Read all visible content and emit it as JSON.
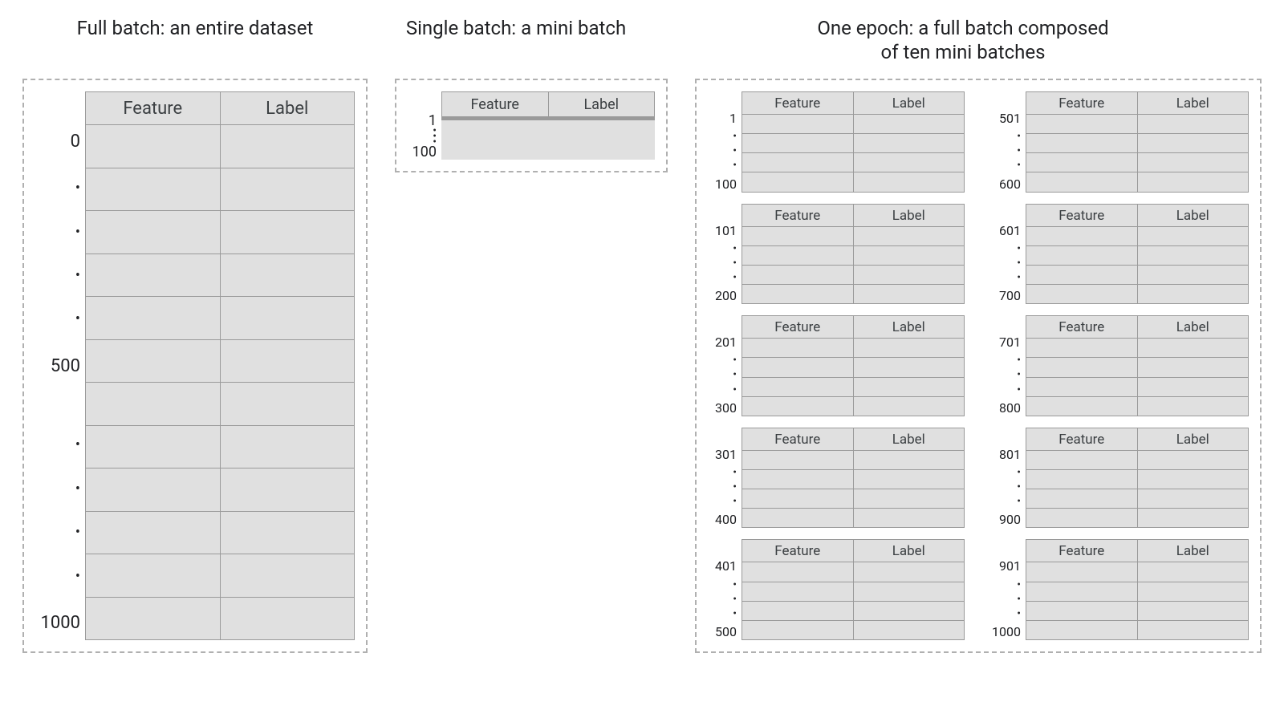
{
  "titles": {
    "full": "Full batch: an entire dataset",
    "single": "Single batch: a mini batch",
    "epoch": "One epoch: a full batch composed\nof ten mini batches"
  },
  "headers": {
    "feature": "Feature",
    "label": "Label"
  },
  "full_batch": {
    "row_labels": [
      "0",
      "•",
      "•",
      "•",
      "•",
      "500",
      "",
      "•",
      "•",
      "•",
      "•",
      "1000"
    ],
    "n_rows": 12
  },
  "single_batch": {
    "row_labels": [
      "1",
      "•",
      "•",
      "•",
      "100"
    ],
    "n_rows": 4
  },
  "epoch_batches": [
    {
      "row_labels": [
        "1",
        "•",
        "•",
        "•",
        "100"
      ]
    },
    {
      "row_labels": [
        "501",
        "•",
        "•",
        "•",
        "600"
      ]
    },
    {
      "row_labels": [
        "101",
        "•",
        "•",
        "•",
        "200"
      ]
    },
    {
      "row_labels": [
        "601",
        "•",
        "•",
        "•",
        "700"
      ]
    },
    {
      "row_labels": [
        "201",
        "•",
        "•",
        "•",
        "300"
      ]
    },
    {
      "row_labels": [
        "701",
        "•",
        "•",
        "•",
        "800"
      ]
    },
    {
      "row_labels": [
        "301",
        "•",
        "•",
        "•",
        "400"
      ]
    },
    {
      "row_labels": [
        "801",
        "•",
        "•",
        "•",
        "900"
      ]
    },
    {
      "row_labels": [
        "401",
        "•",
        "•",
        "•",
        "500"
      ]
    },
    {
      "row_labels": [
        "901",
        "•",
        "•",
        "•",
        "1000"
      ]
    }
  ],
  "epoch_n_rows": 4
}
